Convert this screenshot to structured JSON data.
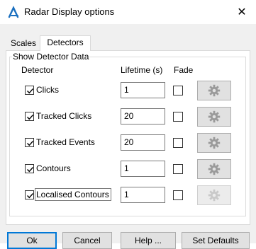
{
  "window": {
    "title": "Radar Display options",
    "close_glyph": "✕"
  },
  "tabs": [
    {
      "label": "Scales",
      "active": false
    },
    {
      "label": "Detectors",
      "active": true
    }
  ],
  "group": {
    "legend": "Show Detector Data",
    "headers": {
      "detector": "Detector",
      "lifetime": "Lifetime (s)",
      "fade": "Fade"
    }
  },
  "detectors": [
    {
      "label": "Clicks",
      "checked": true,
      "lifetime": "1",
      "fade": false,
      "settings_enabled": true
    },
    {
      "label": "Tracked Clicks",
      "checked": true,
      "lifetime": "20",
      "fade": false,
      "settings_enabled": true
    },
    {
      "label": "Tracked Events",
      "checked": true,
      "lifetime": "20",
      "fade": false,
      "settings_enabled": true
    },
    {
      "label": "Contours",
      "checked": true,
      "lifetime": "1",
      "fade": false,
      "settings_enabled": true
    },
    {
      "label": "Localised Contours",
      "checked": true,
      "lifetime": "1",
      "fade": false,
      "settings_enabled": false
    }
  ],
  "buttons": {
    "ok": "Ok",
    "cancel": "Cancel",
    "help": "Help ...",
    "defaults": "Set Defaults"
  },
  "colors": {
    "accent": "#0078d7",
    "icon": "#1a6fbf"
  }
}
